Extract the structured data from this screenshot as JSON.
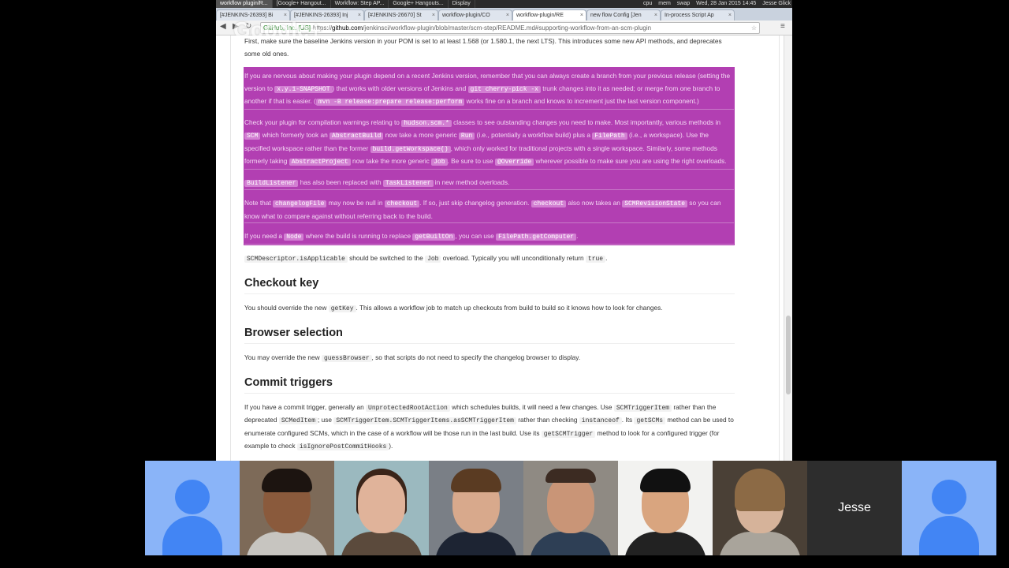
{
  "system_bar": {
    "tasks": [
      "workflow plugin/R...",
      "[Google+ Hangout...",
      "Workflow: Step AP...",
      "Google+ Hangouts...",
      "Display"
    ],
    "status": [
      "cpu",
      "mem",
      "swap"
    ],
    "datetime": "Wed, 28 Jan 2015 14:45",
    "user": "Jesse Glick"
  },
  "browser": {
    "tabs": [
      "[#JENKINS-26393] Bi",
      "[#JENKINS-26393] Inj",
      "[#JENKINS-26670] St",
      "workflow-plugin/CO",
      "workflow-plugin/RE",
      "new flow Config [Jen",
      "In-process Script Ap"
    ],
    "active_tab": 4,
    "ev_badge": "GitHub, Inc. [US]",
    "url_scheme": "https://",
    "url_host": "github.com",
    "url_path": "/jenkinsci/workflow-plugin/blob/master/scm-step/README.md#supporting-workflow-from-an-scm-plugin"
  },
  "overlay_brand": "Google+",
  "article": {
    "intro": {
      "t1": "First, make sure the baseline Jenkins version in your POM is set to at least 1.568 (or 1.580.1, the next LTS). This introduces some new API methods, and deprecates some old ones."
    },
    "p1": {
      "t1": "If you are nervous about making your plugin depend on a recent Jenkins version, remember that you can always create a branch from your previous release (setting the version to ",
      "c1": "x.y.1-SNAPSHOT",
      "t2": ") that works with older versions of Jenkins and ",
      "c2": "git cherry-pick -x",
      "t3": " trunk changes into it as needed; or merge from one branch to another if that is easier. (",
      "c3": "mvn -B release:prepare release:perform",
      "t4": " works fine on a branch and knows to increment just the last version component.)"
    },
    "p2": {
      "t1": "Check your plugin for compilation warnings relating to ",
      "c1": "hudson.scm.*",
      "t2": " classes to see outstanding changes you need to make. Most importantly, various methods in ",
      "c2": "SCM",
      "t3": " which formerly took an ",
      "c3": "AbstractBuild",
      "t4": " now take a more generic ",
      "c4": "Run",
      "t5": " (i.e., potentially a workflow build) plus a ",
      "c5": "FilePath",
      "t6": " (i.e., a workspace). Use the specified workspace rather than the former ",
      "c6": "build.getWorkspace()",
      "t7": ", which only worked for traditional projects with a single workspace. Similarly, some methods formerly taking ",
      "c7": "AbstractProject",
      "t8": " now take the more generic ",
      "c8": "Job",
      "t9": ". Be sure to use ",
      "c9": "@Override",
      "t10": " wherever possible to make sure you are using the right overloads."
    },
    "p3": {
      "c1": "BuildListener",
      "t1": " has also been replaced with ",
      "c2": "TaskListener",
      "t2": " in new method overloads."
    },
    "p4": {
      "t1": "Note that ",
      "c1": "changelogFile",
      "t2": " may now be null in ",
      "c2": "checkout",
      "t3": ". If so, just skip changelog generation. ",
      "c3": "checkout",
      "t4": " also now takes an ",
      "c4": "SCMRevisionState",
      "t5": " so you can know what to compare against without referring back to the build."
    },
    "p5": {
      "t1": "If you need a ",
      "c1": "Node",
      "t2": " where the build is running to replace ",
      "c2": "getBuiltOn",
      "t3": ", you can use ",
      "c3": "FilePath.getComputer",
      "t4": "."
    },
    "p6": {
      "c1": "SCMDescriptor.isApplicable",
      "t1": " should be switched to the ",
      "c2": "Job",
      "t2": " overload. Typically you will unconditionally return ",
      "c3": "true",
      "t3": "."
    },
    "h_checkout": "Checkout key",
    "p7": {
      "t1": "You should override the new ",
      "c1": "getKey",
      "t2": ". This allows a workflow job to match up checkouts from build to build so it knows how to look for changes."
    },
    "h_browser": "Browser selection",
    "p8": {
      "t1": "You may override the new ",
      "c1": "guessBrowser",
      "t2": ", so that scripts do not need to specify the changelog browser to display."
    },
    "h_commit": "Commit triggers",
    "p9": {
      "t1": "If you have a commit trigger, generally an ",
      "c1": "UnprotectedRootAction",
      "t2": " which schedules builds, it will need a few changes. Use ",
      "c2": "SCMTriggerItem",
      "t3": " rather than the deprecated ",
      "c3": "SCMedItem",
      "t4": "; use ",
      "c4": "SCMTriggerItem.SCMTriggerItems.asSCMTriggerItem",
      "t5": " rather than checking ",
      "c5": "instanceof",
      "t6": ". Its ",
      "c6": "getSCMs",
      "t7": " method can be used to enumerate configured SCMs, which in the case of a workflow will be those run in the last build. Use its ",
      "c7": "getSCMTrigger",
      "t8": " method to look for a configured trigger (for example to check ",
      "c8": "isIgnorePostCommitHooks",
      "t9": ")."
    }
  },
  "participants": {
    "name_tile": "Jesse"
  },
  "colors": {
    "selection": "#b23fb2",
    "avatar_bg": "#8ab4f8",
    "avatar_fg": "#4285f4"
  }
}
